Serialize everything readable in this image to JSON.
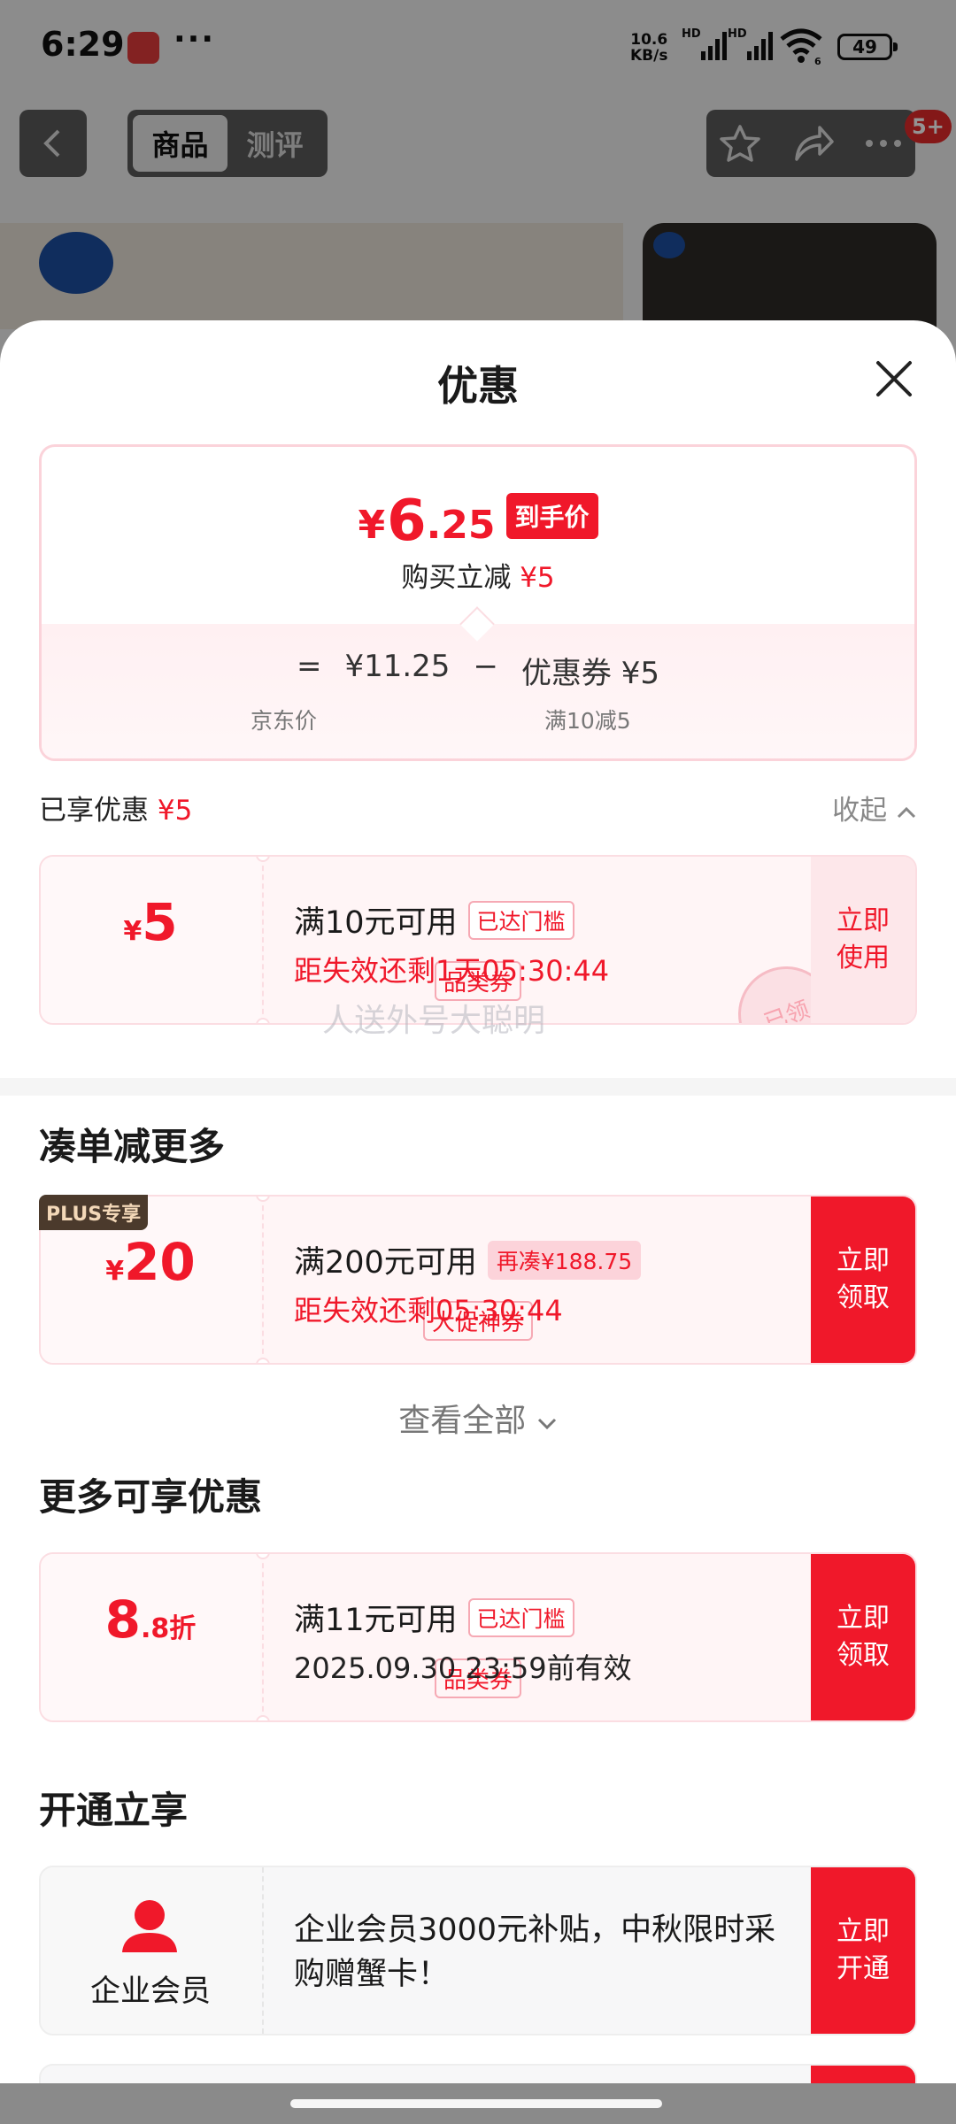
{
  "status": {
    "time": "6:29",
    "dots": "···",
    "net_speed": "10.6",
    "net_unit": "KB/s",
    "hd1": "HD",
    "hd2": "HD",
    "sim": "6",
    "battery": "49"
  },
  "topbar": {
    "tab_product": "商品",
    "tab_review": "测评",
    "badge": "5+"
  },
  "sheet": {
    "title": "优惠"
  },
  "price": {
    "yen": "¥",
    "int": "6",
    "dec": ".25",
    "tag": "到手价",
    "sub_label": "购买立减 ",
    "sub_value": "¥5"
  },
  "formula": {
    "eq": "=",
    "jd_price": "¥11.25",
    "minus": "−",
    "coupon": "优惠券 ¥5",
    "note_jd": "京东价",
    "note_coupon": "满10减5"
  },
  "enjoyed": {
    "label": "已享优惠 ",
    "value": "¥5",
    "collapse": "收起"
  },
  "coupon1": {
    "yen": "¥",
    "amount": "5",
    "kind": "品类券",
    "cond": "满10元可用",
    "chip": "已达门槛",
    "expire": "距失效还剩1天05:30:44",
    "action_l1": "立即",
    "action_l2": "使用",
    "stamp": "已领"
  },
  "watermark": "人送外号大聪明",
  "section_more": "凑单减更多",
  "coupon2": {
    "plus": "PLUS专享",
    "yen": "¥",
    "amount": "20",
    "kind": "大促神券",
    "cond": "满200元可用",
    "chip": "再凑¥188.75",
    "expire": "距失效还剩05:30:44",
    "action_l1": "立即",
    "action_l2": "领取"
  },
  "view_all": "查看全部",
  "section_extra": "更多可享优惠",
  "coupon3": {
    "amount_int": "8",
    "amount_dec": ".8折",
    "kind": "品类券",
    "cond": "满11元可用",
    "chip": "已达门槛",
    "expire": "2025.09.30 23:59前有效",
    "action_l1": "立即",
    "action_l2": "领取"
  },
  "section_open": "开通立享",
  "member": {
    "label": "企业会员",
    "desc": "企业会员3000元补贴，中秋限时采购赠蟹卡！",
    "action_l1": "立即",
    "action_l2": "开通"
  },
  "colors": {
    "accent": "#f0182a",
    "card_border": "#fbdde2"
  }
}
